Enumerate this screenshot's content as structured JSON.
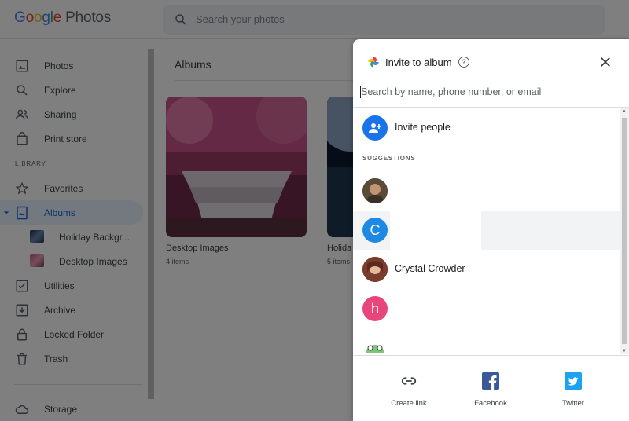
{
  "app": {
    "logo_parts": [
      "G",
      "o",
      "o",
      "g",
      "l",
      "e"
    ],
    "product": "Photos"
  },
  "search": {
    "placeholder": "Search your photos"
  },
  "sidebar": {
    "items": [
      {
        "label": "Photos",
        "icon": "photo-icon"
      },
      {
        "label": "Explore",
        "icon": "search-icon"
      },
      {
        "label": "Sharing",
        "icon": "people-icon"
      },
      {
        "label": "Print store",
        "icon": "shopping-bag-icon"
      }
    ],
    "section_label": "LIBRARY",
    "library_items": [
      {
        "label": "Favorites",
        "icon": "star-icon"
      },
      {
        "label": "Albums",
        "icon": "album-icon",
        "active": true
      },
      {
        "label": "Holiday Backgr...",
        "icon": "album-thumb"
      },
      {
        "label": "Desktop Images",
        "icon": "album-thumb"
      },
      {
        "label": "Utilities",
        "icon": "checkbox-icon"
      },
      {
        "label": "Archive",
        "icon": "archive-icon"
      },
      {
        "label": "Locked Folder",
        "icon": "lock-icon"
      },
      {
        "label": "Trash",
        "icon": "trash-icon"
      }
    ],
    "storage_label": "Storage"
  },
  "main": {
    "title": "Albums",
    "albums": [
      {
        "name": "Desktop Images",
        "count": "4 items"
      },
      {
        "name": "Holida",
        "count": "5 items"
      }
    ]
  },
  "dialog": {
    "title": "Invite to album",
    "search_placeholder": "Search by name, phone number, or email",
    "invite_label": "Invite people",
    "suggestions_label": "SUGGESTIONS",
    "suggestions": [
      {
        "letter": "",
        "name": "",
        "color": "#6b5b45"
      },
      {
        "letter": "C",
        "name": "",
        "color": "#1e88e5"
      },
      {
        "letter": "",
        "name": "Crystal Crowder",
        "color": "#8a5a44"
      },
      {
        "letter": "h",
        "name": "",
        "color": "#e8457a"
      },
      {
        "letter": "",
        "name": "",
        "color": "#ffffff"
      }
    ],
    "share_options": [
      {
        "label": "Create link",
        "icon": "link-icon"
      },
      {
        "label": "Facebook",
        "icon": "facebook-icon"
      },
      {
        "label": "Twitter",
        "icon": "twitter-icon"
      }
    ]
  },
  "colors": {
    "accent": "#1a73e8",
    "facebook": "#3b5998",
    "twitter": "#1da1f2",
    "overlay": "rgba(0,0,0,0.5)"
  }
}
